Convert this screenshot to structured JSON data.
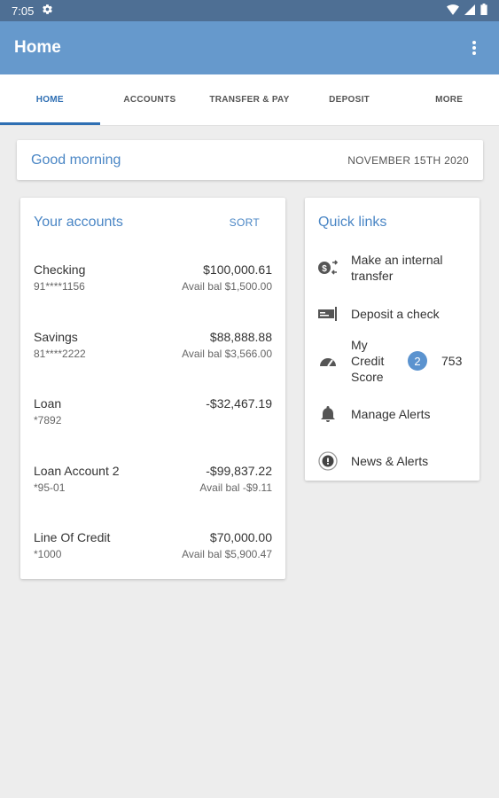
{
  "status_bar": {
    "time": "7:05",
    "icons": [
      "gear-icon",
      "wifi-icon",
      "signal-icon",
      "battery-icon"
    ]
  },
  "app_bar": {
    "title": "Home",
    "menu_icon": "more-vertical-icon"
  },
  "tabs": [
    {
      "label": "HOME",
      "active": true
    },
    {
      "label": "ACCOUNTS",
      "active": false
    },
    {
      "label": "TRANSFER & PAY",
      "active": false
    },
    {
      "label": "DEPOSIT",
      "active": false
    },
    {
      "label": "MORE",
      "active": false
    }
  ],
  "greeting": {
    "text": "Good morning",
    "date": "NOVEMBER 15TH 2020"
  },
  "accounts": {
    "title": "Your accounts",
    "sort_label": "SORT",
    "items": [
      {
        "name": "Checking",
        "number": "91****1156",
        "balance": "$100,000.61",
        "available": "Avail bal $1,500.00"
      },
      {
        "name": "Savings",
        "number": "81****2222",
        "balance": "$88,888.88",
        "available": "Avail bal $3,566.00"
      },
      {
        "name": "Loan",
        "number": "*7892",
        "balance": "-$32,467.19",
        "available": ""
      },
      {
        "name": "Loan Account 2",
        "number": "*95-01",
        "balance": "-$99,837.22",
        "available": "Avail bal -$9.11"
      },
      {
        "name": "Line Of Credit",
        "number": "*1000",
        "balance": "$70,000.00",
        "available": "Avail bal $5,900.47"
      }
    ]
  },
  "quick_links": {
    "title": "Quick links",
    "items": [
      {
        "label": "Make an internal transfer",
        "icon": "transfer-icon"
      },
      {
        "label": "Deposit a check",
        "icon": "check-deposit-icon"
      },
      {
        "label": "My Credit Score",
        "icon": "speedometer-icon",
        "badge": "2",
        "score": "753"
      },
      {
        "label": "Manage Alerts",
        "icon": "bell-icon"
      },
      {
        "label": "News & Alerts",
        "icon": "info-icon"
      }
    ]
  },
  "colors": {
    "status_bar": "#4e6f94",
    "app_bar": "#6699cc",
    "accent": "#2f6fb3",
    "link_text": "#4a86c5",
    "background": "#ededed"
  }
}
